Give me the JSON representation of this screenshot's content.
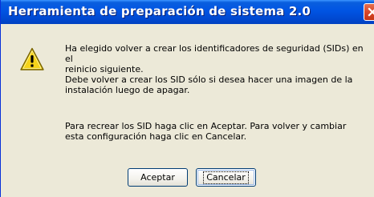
{
  "window": {
    "title": "Herramienta de preparación de sistema 2.0"
  },
  "icons": {
    "status": "warning-icon",
    "close": "close-icon"
  },
  "colors": {
    "titlebar": "#0054e3",
    "dialog_bg": "#ece9d8",
    "close_button": "#d8472a",
    "warning_yellow": "#f5d31a"
  },
  "message": {
    "paragraph1_lines": [
      "Ha elegido volver a crear los identificadores de seguridad (SIDs) en",
      "el",
      "reinicio siguiente.",
      "Debe volver a crear los SID sólo si desea hacer una imagen de la",
      "instalación luego de apagar."
    ],
    "paragraph2_lines": [
      "Para recrear los SID haga clic en Aceptar. Para volver y cambiar",
      "esta configuración haga clic en Cancelar."
    ]
  },
  "buttons": {
    "accept_label": "Aceptar",
    "cancel_label": "Cancelar"
  }
}
